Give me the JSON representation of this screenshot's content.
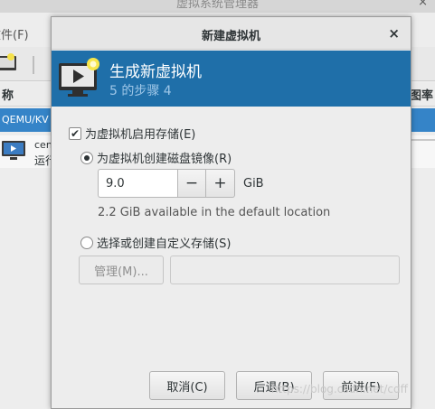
{
  "background_window": {
    "title": "虚拟系统管理器",
    "close_glyph": "×",
    "menu_text": "文件(F)",
    "column_left": "称",
    "column_right": "图率",
    "selected_row": "QEMU/KV",
    "vm_name": "cen",
    "vm_status": "运行"
  },
  "dialog": {
    "title": "新建虚拟机",
    "close_glyph": "×",
    "banner_title": "生成新虚拟机",
    "banner_step": "5 的步骤 4",
    "enable_storage_label": "为虚拟机启用存储(E)",
    "enable_storage_checked": true,
    "create_disk_label": "为虚拟机创建磁盘镜像(R)",
    "create_disk_selected": true,
    "disk_size_value": "9.0",
    "minus_glyph": "−",
    "plus_glyph": "+",
    "disk_unit": "GiB",
    "available_text": "2.2 GiB available in the default location",
    "custom_storage_label": "选择或创建自定义存储(S)",
    "custom_storage_selected": false,
    "manage_button": "管理(M)...",
    "custom_path_value": "",
    "cancel_button": "取消(C)",
    "back_button": "后退(B)",
    "forward_button": "前进(F)"
  },
  "colors": {
    "banner": "#1f6fa9",
    "selection": "#3584c8"
  },
  "watermark": "https://blog.csdn.net/cdff"
}
